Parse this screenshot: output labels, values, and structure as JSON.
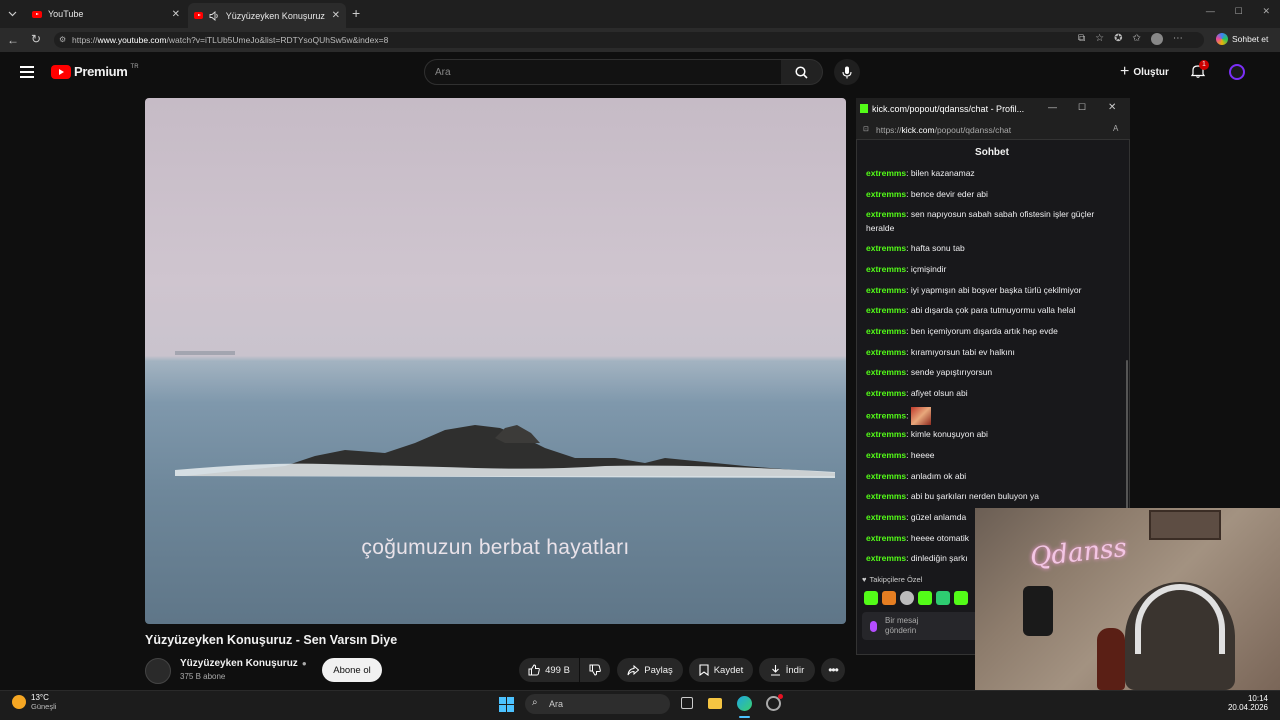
{
  "browser": {
    "tabs": [
      {
        "label": "YouTube"
      },
      {
        "label": "Yüzyüzeyken Konuşuruz - Sen"
      }
    ],
    "url_prefix": "https://",
    "url_domain": "www.youtube.com",
    "url_path": "/watch?v=iTLUb5UmeJo&list=RDTYsoQUhSw5w&index=8",
    "copilot_label": "Sohbet et"
  },
  "youtube": {
    "logo_text": "Premium",
    "region": "TR",
    "search_placeholder": "Ara",
    "create_label": "Oluştur",
    "notif_count": "1",
    "video": {
      "subtitle": "çoğumuzun berbat hayatları",
      "title": "Yüzyüzeyken Konuşuruz - Sen Varsın Diye"
    },
    "channel": {
      "name": "Yüzyüzeyken Konuşuruz",
      "subscribers": "375 B abone",
      "subscribe_label": "Abone ol"
    },
    "actions": {
      "likes": "499 B",
      "share": "Paylaş",
      "save": "Kaydet",
      "download": "İndir"
    }
  },
  "popout": {
    "title": "kick.com/popout/qdanss/chat - Profil...",
    "url_prefix": "https://",
    "url_domain": "kick.com",
    "url_path": "/popout/qdanss/chat",
    "chat_header": "Sohbet",
    "messages": [
      {
        "user": "extremms",
        "text": ": bilen kazanamaz"
      },
      {
        "user": "extremms",
        "text": ": bence devir eder abi"
      },
      {
        "user": "extremms",
        "text": ": sen napıyosun sabah sabah ofistesin işler güçler heralde"
      },
      {
        "user": "extremms",
        "text": ": hafta sonu tab"
      },
      {
        "user": "extremms",
        "text": ": içmişindir"
      },
      {
        "user": "extremms",
        "text": ": iyi yapmışın abi boşver başka türlü çekilmiyor"
      },
      {
        "user": "extremms",
        "text": ": abi dışarda çok para tutmuyormu valla helal"
      },
      {
        "user": "extremms",
        "text": ": ben içemiyorum dışarda artık hep evde"
      },
      {
        "user": "extremms",
        "text": ": kıramıyorsun tabi ev halkını"
      },
      {
        "user": "extremms",
        "text": ": sende yapıştırıyorsun"
      },
      {
        "user": "extremms",
        "text": ": afiyet olsun abi"
      },
      {
        "user": "extremms",
        "text": ":"
      },
      {
        "user": "extremms",
        "text": ": kimle konuşuyon abi"
      },
      {
        "user": "extremms",
        "text": ": heeee"
      },
      {
        "user": "extremms",
        "text": ": anladım ok abi"
      },
      {
        "user": "extremms",
        "text": ": abi bu şarkıları nerden buluyon ya"
      },
      {
        "user": "extremms",
        "text": ": güzel anlamda"
      },
      {
        "user": "extremms",
        "text": ": heeee otomatik"
      },
      {
        "user": "extremms",
        "text": ": dinlediğin şarkı"
      }
    ],
    "followers_only": "Takipçilere Özel",
    "input_placeholder": "Bir mesaj gönderin"
  },
  "webcam": {
    "neon_text": "Qdanss"
  },
  "taskbar": {
    "temperature": "13°C",
    "weather": "Güneşli",
    "search_label": "Ara",
    "time": "10:14",
    "date": "20.04.2026"
  }
}
